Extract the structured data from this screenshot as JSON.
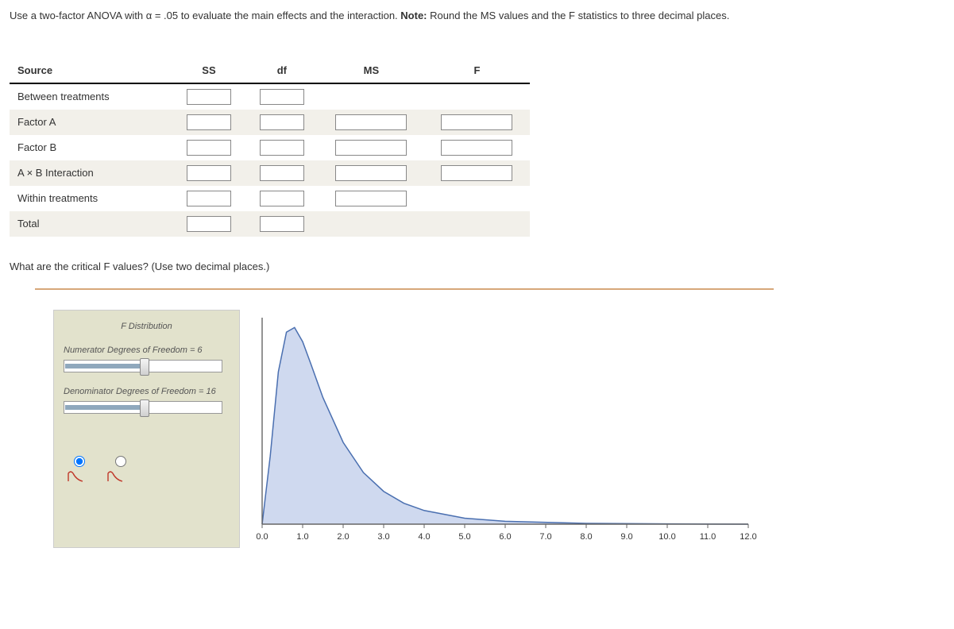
{
  "instruction_pre": "Use a two-factor ANOVA with α = .05 to evaluate the main effects and the interaction. ",
  "instruction_note_label": "Note:",
  "instruction_post": " Round the MS values and the F statistics to three decimal places.",
  "anova": {
    "headers": {
      "source": "Source",
      "ss": "SS",
      "df": "df",
      "ms": "MS",
      "f": "F"
    },
    "rows": {
      "between": "Between treatments",
      "factorA": "Factor A",
      "factorB": "Factor B",
      "interaction": "A × B Interaction",
      "within": "Within treatments",
      "total": "Total"
    }
  },
  "question2": "What are the critical F values? (Use two decimal places.)",
  "panel": {
    "title": "F Distribution",
    "num_label": "Numerator Degrees of Freedom = 6",
    "den_label": "Denominator Degrees of Freedom = 16"
  },
  "chart_data": {
    "type": "line",
    "title": "F Distribution",
    "params": {
      "numerator_df": 6,
      "denominator_df": 16
    },
    "xlabel": "",
    "ylabel": "",
    "xlim": [
      0,
      12
    ],
    "x_ticks": [
      "0.0",
      "1.0",
      "2.0",
      "3.0",
      "4.0",
      "5.0",
      "6.0",
      "7.0",
      "8.0",
      "9.0",
      "10.0",
      "11.0",
      "12.0"
    ],
    "series": [
      {
        "name": "F pdf (df1=6, df2=16)",
        "x": [
          0.0,
          0.2,
          0.4,
          0.6,
          0.8,
          1.0,
          1.2,
          1.5,
          2.0,
          2.5,
          3.0,
          3.5,
          4.0,
          5.0,
          6.0,
          8.0,
          10.0,
          12.0
        ],
        "values": [
          0.0,
          0.264,
          0.59,
          0.744,
          0.762,
          0.707,
          0.622,
          0.491,
          0.317,
          0.2,
          0.127,
          0.081,
          0.053,
          0.023,
          0.011,
          0.003,
          0.001,
          0.0
        ]
      }
    ]
  }
}
